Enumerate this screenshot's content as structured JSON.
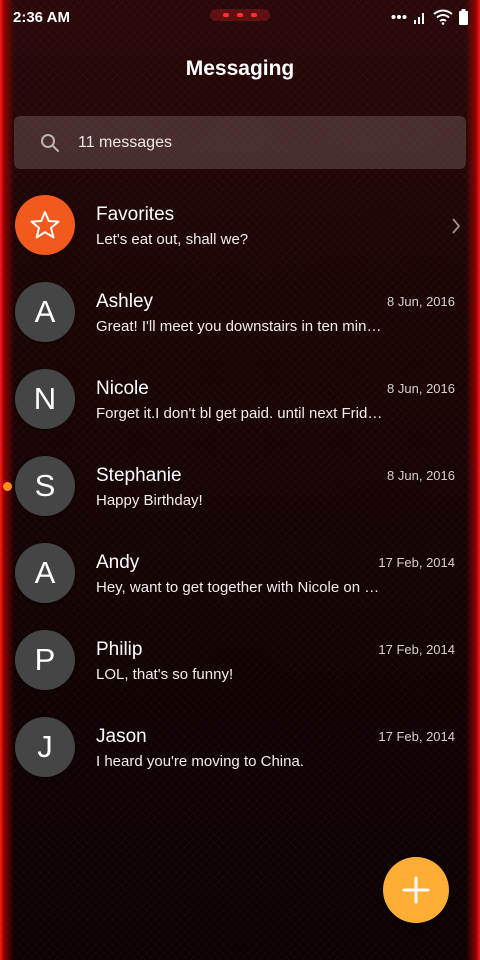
{
  "status_bar": {
    "time": "2:36 AM",
    "icons": [
      "notification-dots-icon",
      "signal-icon",
      "wifi-icon",
      "battery-icon"
    ]
  },
  "header": {
    "title": "Messaging"
  },
  "search": {
    "text": "11 messages",
    "icon": "search-icon"
  },
  "conversations": [
    {
      "avatar": "",
      "icon": "star-icon",
      "name": "Favorites",
      "date": "",
      "snippet": "Let's eat out, shall we?",
      "has_chevron": true,
      "unread": false
    },
    {
      "avatar": "A",
      "name": "Ashley",
      "date": "8 Jun, 2016",
      "snippet": "Great! I'll meet you downstairs in ten min…",
      "unread": false
    },
    {
      "avatar": "N",
      "name": "Nicole",
      "date": "8 Jun, 2016",
      "snippet": "Forget it.I don't bl get paid. until next Frid…",
      "unread": false
    },
    {
      "avatar": "S",
      "name": "Stephanie",
      "date": "8 Jun, 2016",
      "snippet": "Happy Birthday!",
      "unread": true
    },
    {
      "avatar": "A",
      "name": "Andy",
      "date": "17 Feb, 2014",
      "snippet": "Hey, want to get together with Nicole on …",
      "unread": false
    },
    {
      "avatar": "P",
      "name": "Philip",
      "date": "17 Feb, 2014",
      "snippet": "LOL, that's so funny!",
      "unread": false
    },
    {
      "avatar": "J",
      "name": "Jason",
      "date": "17 Feb, 2014",
      "snippet": "I heard you're moving to China.",
      "unread": false
    }
  ],
  "fab": {
    "icon": "plus-icon"
  },
  "colors": {
    "accent_fab": "#ffae35",
    "favorites_avatar": "#f25a1d",
    "avatar_default": "#454545",
    "edge_glow": "#ff1a1a",
    "unread_dot": "#ff8c1a"
  }
}
